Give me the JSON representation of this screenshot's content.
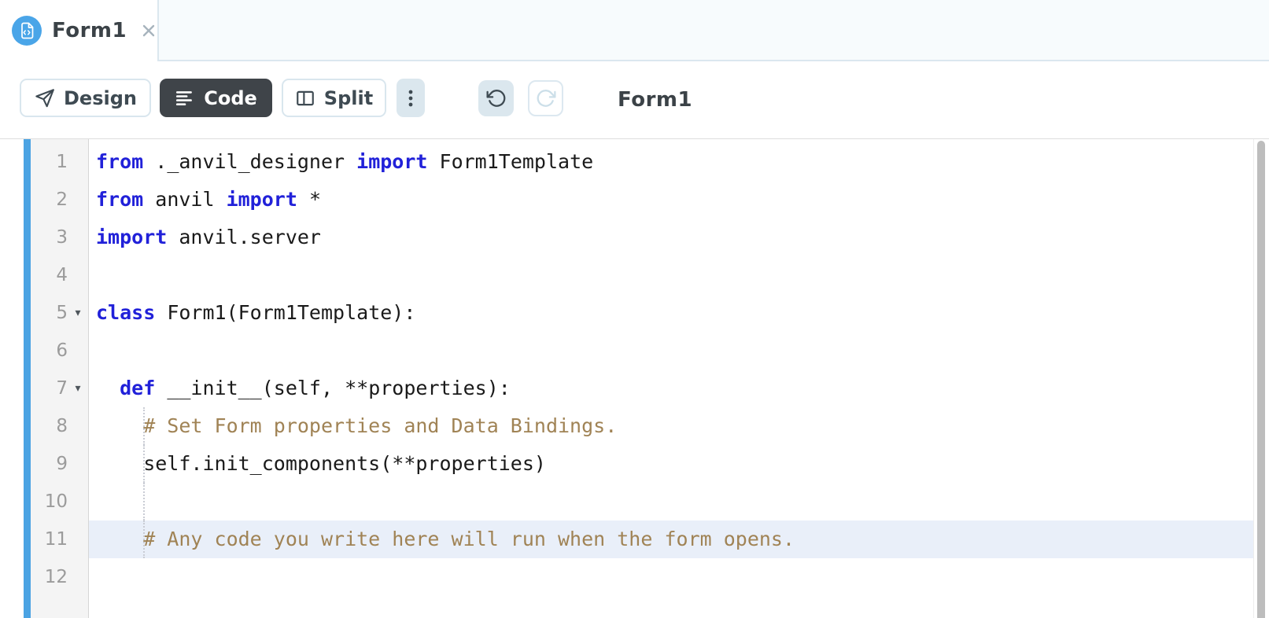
{
  "tab": {
    "title": "Form1",
    "icon": "code-file-icon"
  },
  "toolbar": {
    "design_label": "Design",
    "code_label": "Code",
    "split_label": "Split",
    "form_title": "Form1",
    "icons": {
      "design": "paper-plane-icon",
      "code": "align-left-lines-icon",
      "split": "split-pane-icon",
      "menu": "kebab-menu-icon",
      "undo": "undo-arrow-icon",
      "redo": "redo-arrow-icon"
    }
  },
  "editor": {
    "language": "python",
    "active_line": 11,
    "lines": [
      {
        "number": "1",
        "fold": false,
        "highlight": false,
        "guide": false,
        "tokens": [
          [
            "kw",
            "from"
          ],
          [
            "txt",
            " ._anvil_designer "
          ],
          [
            "kw",
            "import"
          ],
          [
            "txt",
            " Form1Template"
          ]
        ]
      },
      {
        "number": "2",
        "fold": false,
        "highlight": false,
        "guide": false,
        "tokens": [
          [
            "kw",
            "from"
          ],
          [
            "txt",
            " anvil "
          ],
          [
            "kw",
            "import"
          ],
          [
            "txt",
            " *"
          ]
        ]
      },
      {
        "number": "3",
        "fold": false,
        "highlight": false,
        "guide": false,
        "tokens": [
          [
            "kw",
            "import"
          ],
          [
            "txt",
            " anvil.server"
          ]
        ]
      },
      {
        "number": "4",
        "fold": false,
        "highlight": false,
        "guide": false,
        "tokens": []
      },
      {
        "number": "5",
        "fold": true,
        "highlight": false,
        "guide": false,
        "tokens": [
          [
            "kw",
            "class"
          ],
          [
            "txt",
            " Form1(Form1Template):"
          ]
        ]
      },
      {
        "number": "6",
        "fold": false,
        "highlight": false,
        "guide": false,
        "tokens": []
      },
      {
        "number": "7",
        "fold": true,
        "highlight": false,
        "guide": false,
        "tokens": [
          [
            "txt",
            "  "
          ],
          [
            "kw",
            "def"
          ],
          [
            "txt",
            " __init__(self, **properties):"
          ]
        ]
      },
      {
        "number": "8",
        "fold": false,
        "highlight": false,
        "guide": true,
        "tokens": [
          [
            "com",
            "    # Set Form properties and Data Bindings."
          ]
        ]
      },
      {
        "number": "9",
        "fold": false,
        "highlight": false,
        "guide": true,
        "tokens": [
          [
            "txt",
            "    self.init_components(**properties)"
          ]
        ]
      },
      {
        "number": "10",
        "fold": false,
        "highlight": false,
        "guide": true,
        "tokens": []
      },
      {
        "number": "11",
        "fold": false,
        "highlight": true,
        "guide": true,
        "tokens": [
          [
            "com",
            "    # Any code you write here will run when the form opens."
          ]
        ]
      },
      {
        "number": "12",
        "fold": false,
        "highlight": false,
        "guide": false,
        "tokens": []
      }
    ]
  },
  "colors": {
    "accent_blue": "#4ba3e3",
    "tab_icon_blue": "#4aa5e8",
    "keyword_blue": "#2121d9",
    "comment_tan": "#a08355",
    "active_line_bg": "#e9eff9",
    "dark_button_bg": "#3f4449",
    "button_border": "#d9e6ee",
    "soft_button_bg": "#dbe7ee",
    "gutter_bg": "#f4f4f4"
  }
}
